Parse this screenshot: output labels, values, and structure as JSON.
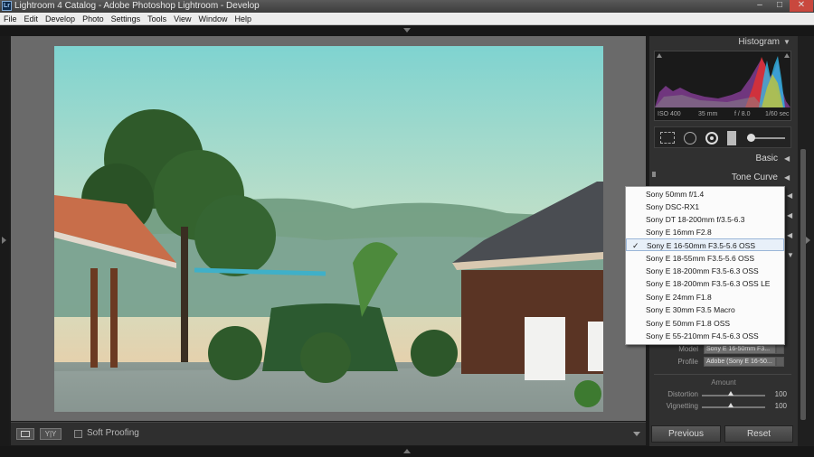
{
  "window": {
    "title": "Lightroom 4 Catalog - Adobe Photoshop Lightroom - Develop",
    "app_icon_text": "Lr",
    "controls": {
      "minimize": "–",
      "maximize": "□",
      "close": "✕"
    }
  },
  "menu": [
    "File",
    "Edit",
    "Develop",
    "Photo",
    "Settings",
    "Tools",
    "View",
    "Window",
    "Help"
  ],
  "histogram": {
    "title": "Histogram",
    "iso": "ISO 400",
    "focal": "35 mm",
    "aperture": "f / 8.0",
    "shutter": "1/60 sec"
  },
  "panels": {
    "basic": "Basic",
    "tone_curve": "Tone Curve"
  },
  "lens_menu": {
    "items": [
      "Sony 50mm f/1.4",
      "Sony DSC-RX1",
      "Sony DT 18-200mm f/3.5-6.3",
      "Sony E 16mm F2.8",
      "Sony E 16-50mm F3.5-5.6 OSS",
      "Sony E 18-55mm F3.5-5.6 OSS",
      "Sony E 18-200mm F3.5-6.3 OSS",
      "Sony E 18-200mm F3.5-6.3 OSS LE",
      "Sony E 24mm F1.8",
      "Sony E 30mm F3.5 Macro",
      "Sony E 50mm F1.8 OSS",
      "Sony E 55-210mm F4.5-6.3 OSS"
    ],
    "selected_index": 4,
    "check": "✓"
  },
  "lens_profile": {
    "model_label": "Model",
    "model_value": "Sony E 16-50mm F3...",
    "profile_label": "Profile",
    "profile_value": "Adobe (Sony E 16-50...",
    "amount_label": "Amount",
    "distortion_label": "Distortion",
    "distortion_value": "100",
    "vignetting_label": "Vignetting",
    "vignetting_value": "100"
  },
  "toolbar": {
    "view_icon": "loupe-view-icon",
    "compare_label": "Y|Y",
    "soft_proofing": "Soft Proofing"
  },
  "buttons": {
    "previous": "Previous",
    "reset": "Reset"
  },
  "colors": {
    "sky_top": "#7fd3d0",
    "sky_bottom": "#f0c8a0"
  }
}
